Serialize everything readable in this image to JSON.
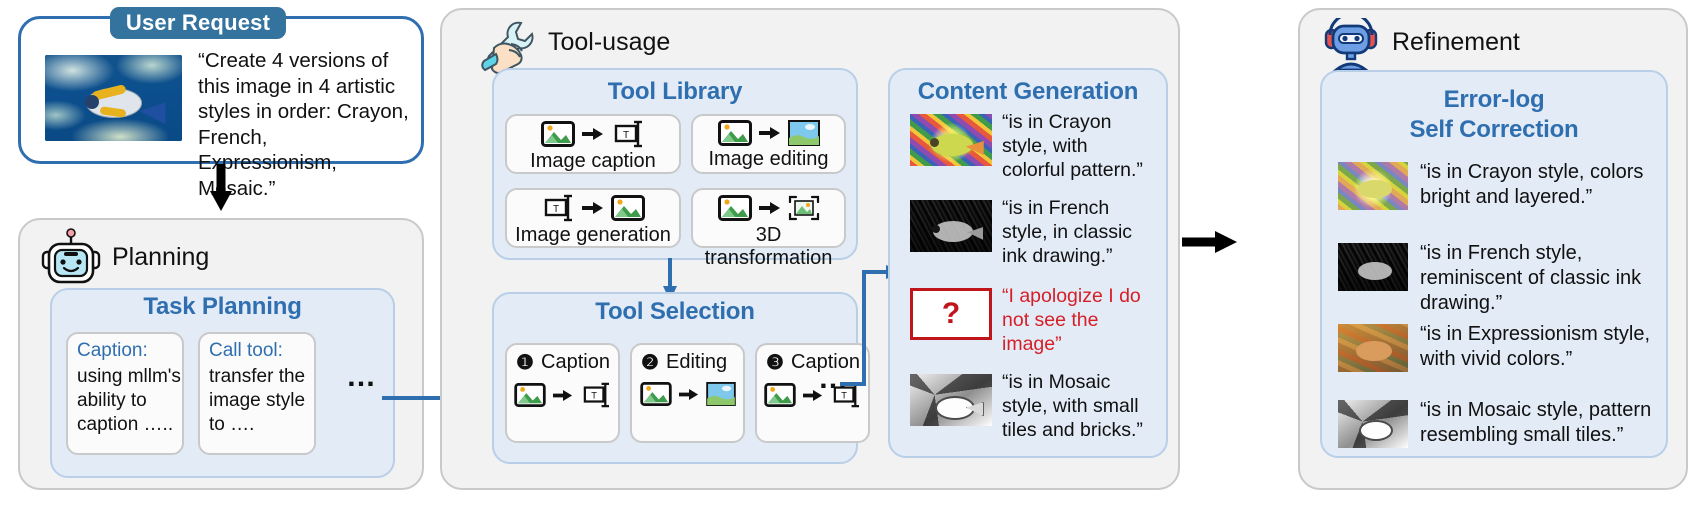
{
  "user_request": {
    "chip_label": "User Request",
    "text": "“Create 4 versions of this image in 4 artistic styles in order: Crayon, French, Expressionism, Mosaic.”",
    "image_alt": "coral-reef-fish-photo"
  },
  "planning": {
    "section_title": "Planning",
    "icon": "robot-head-icon",
    "inner_title": "Task Planning",
    "cards": [
      {
        "label": "Caption:",
        "body": "using mllm's ability to caption ….."
      },
      {
        "label": "Call tool:",
        "body": "transfer the image style to …."
      }
    ],
    "ellipsis": "…"
  },
  "tool_usage": {
    "section_title": "Tool-usage",
    "icon": "hand-wrench-icon",
    "tool_library": {
      "title": "Tool Library",
      "tools": [
        {
          "label": "Image caption",
          "from": "photo-icon",
          "to": "text-icon"
        },
        {
          "label": "Image editing",
          "from": "photo-icon",
          "to": "landscape-icon"
        },
        {
          "label": "Image generation",
          "from": "text-icon",
          "to": "photo-icon"
        },
        {
          "label": "3D transformation",
          "from": "photo-icon",
          "to": "framed-photo-icon"
        }
      ]
    },
    "tool_selection": {
      "title": "Tool Selection",
      "steps": [
        {
          "num": "❶",
          "label": "Caption",
          "from": "photo-icon",
          "to": "text-icon"
        },
        {
          "num": "❷",
          "label": "Editing",
          "from": "photo-icon",
          "to": "landscape-icon"
        },
        {
          "num": "❸",
          "label": "Caption",
          "from": "photo-icon",
          "to": "text-icon"
        }
      ],
      "ellipsis": "…"
    }
  },
  "content_generation": {
    "title": "Content Generation",
    "items": [
      {
        "style": "crayon",
        "text": "“is in Crayon style, with colorful pattern.”",
        "error": false
      },
      {
        "style": "french",
        "text": "“is in French style, in classic ink drawing.”",
        "error": false
      },
      {
        "style": "error",
        "text": "“I apologize I do not see the image”",
        "error": true,
        "glyph": "?"
      },
      {
        "style": "mosaic",
        "text": "“is in Mosaic style, with small tiles and bricks.”",
        "error": false
      }
    ]
  },
  "refinement": {
    "section_title": "Refinement",
    "icon": "robot-headphones-icon",
    "inner_title_line1": "Error-log",
    "inner_title_line2": "Self Correction",
    "items": [
      {
        "style": "crayon",
        "text": "“is in Crayon style, colors bright and layered.”"
      },
      {
        "style": "french",
        "text": "“is in French style, reminiscent of classic ink drawing.”"
      },
      {
        "style": "expressionism",
        "text": "“is in Expressionism style, with vivid colors.”"
      },
      {
        "style": "mosaic",
        "text": "“is in Mosaic style, pattern resembling small tiles.”"
      }
    ]
  },
  "colors": {
    "accent_blue": "#2f6fb0",
    "chip_blue": "#35739f",
    "inner_fill": "#e2ebf6",
    "inner_border": "#b9cfe8",
    "panel_fill": "#f2f2f2",
    "panel_border": "#c9c9c9",
    "error_red": "#d61f26",
    "arrow_black": "#000000"
  }
}
